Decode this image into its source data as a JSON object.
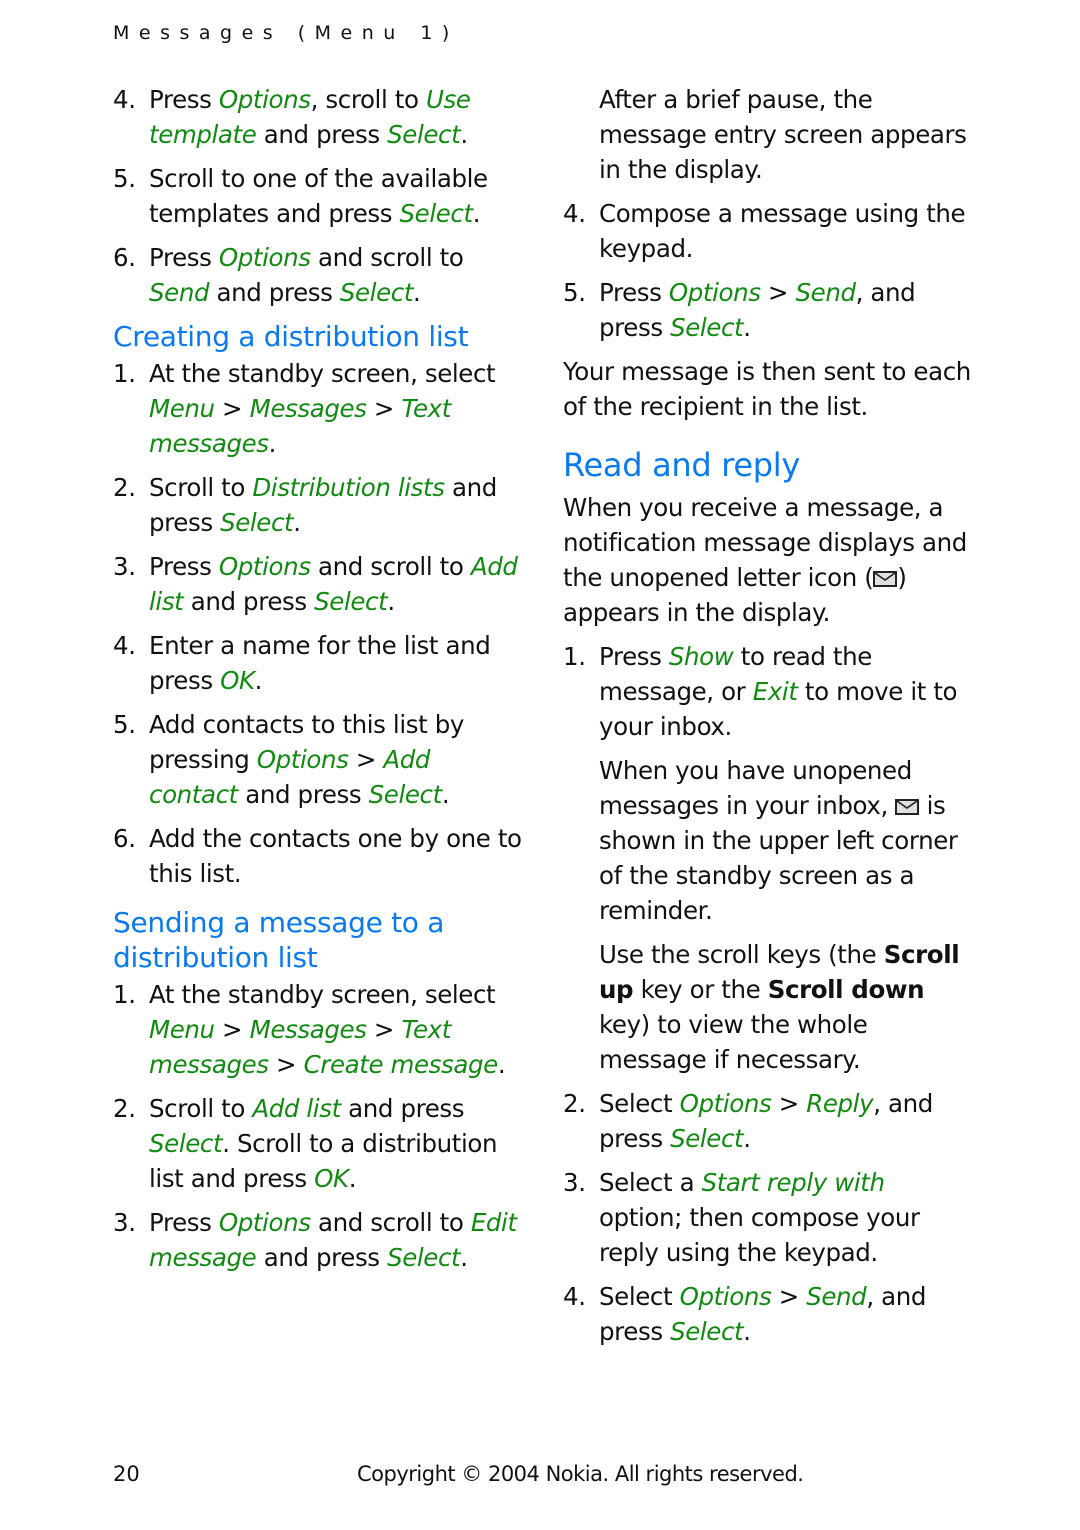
{
  "running_head": "Messages (Menu 1)",
  "left_column": {
    "continued_steps": [
      {
        "num": "4.",
        "parts": [
          [
            "t",
            "Press "
          ],
          [
            "e",
            "Options"
          ],
          [
            "t",
            ", scroll to "
          ],
          [
            "e",
            "Use template"
          ],
          [
            "t",
            " and press "
          ],
          [
            "e",
            "Select"
          ],
          [
            "t",
            "."
          ]
        ]
      },
      {
        "num": "5.",
        "parts": [
          [
            "t",
            "Scroll to one of the available templates and press "
          ],
          [
            "e",
            "Select"
          ],
          [
            "t",
            "."
          ]
        ]
      },
      {
        "num": "6.",
        "parts": [
          [
            "t",
            "Press "
          ],
          [
            "e",
            "Options"
          ],
          [
            "t",
            " and scroll to "
          ],
          [
            "e",
            "Send"
          ],
          [
            "t",
            " and press "
          ],
          [
            "e",
            "Select"
          ],
          [
            "t",
            "."
          ]
        ]
      }
    ],
    "section1": {
      "heading": "Creating a distribution list",
      "steps": [
        {
          "num": "1.",
          "parts": [
            [
              "t",
              "At the standby screen, select "
            ],
            [
              "e",
              "Menu"
            ],
            [
              "t",
              " > "
            ],
            [
              "e",
              "Messages"
            ],
            [
              "t",
              " > "
            ],
            [
              "e",
              "Text messages"
            ],
            [
              "t",
              "."
            ]
          ]
        },
        {
          "num": "2.",
          "parts": [
            [
              "t",
              "Scroll to "
            ],
            [
              "e",
              "Distribution lists"
            ],
            [
              "t",
              " and press "
            ],
            [
              "e",
              "Select"
            ],
            [
              "t",
              "."
            ]
          ]
        },
        {
          "num": "3.",
          "parts": [
            [
              "t",
              "Press "
            ],
            [
              "e",
              "Options"
            ],
            [
              "t",
              " and scroll to "
            ],
            [
              "e",
              "Add list"
            ],
            [
              "t",
              " and press "
            ],
            [
              "e",
              "Select"
            ],
            [
              "t",
              "."
            ]
          ]
        },
        {
          "num": "4.",
          "parts": [
            [
              "t",
              "Enter a name for the list and press "
            ],
            [
              "e",
              "OK"
            ],
            [
              "t",
              "."
            ]
          ]
        },
        {
          "num": "5.",
          "parts": [
            [
              "t",
              "Add contacts to this list by pressing "
            ],
            [
              "e",
              "Options"
            ],
            [
              "t",
              " > "
            ],
            [
              "e",
              "Add contact"
            ],
            [
              "t",
              " and press "
            ],
            [
              "e",
              "Select"
            ],
            [
              "t",
              "."
            ]
          ]
        },
        {
          "num": "6.",
          "parts": [
            [
              "t",
              "Add the contacts one by one to this list."
            ]
          ]
        }
      ]
    },
    "section2": {
      "heading": "Sending a message to a distribution list",
      "steps": [
        {
          "num": "1.",
          "parts": [
            [
              "t",
              "At the standby screen, select "
            ],
            [
              "e",
              "Menu"
            ],
            [
              "t",
              " > "
            ],
            [
              "e",
              "Messages"
            ],
            [
              "t",
              " > "
            ],
            [
              "e",
              "Text messages"
            ],
            [
              "t",
              " > "
            ],
            [
              "e",
              "Create message"
            ],
            [
              "t",
              "."
            ]
          ]
        },
        {
          "num": "2.",
          "parts": [
            [
              "t",
              "Scroll to "
            ],
            [
              "e",
              "Add list"
            ],
            [
              "t",
              " and press "
            ],
            [
              "e",
              "Select"
            ],
            [
              "t",
              ". Scroll to a distribution list and press "
            ],
            [
              "e",
              "OK"
            ],
            [
              "t",
              "."
            ]
          ]
        },
        {
          "num": "3.",
          "parts": [
            [
              "t",
              "Press "
            ],
            [
              "e",
              "Options"
            ],
            [
              "t",
              " and scroll to "
            ],
            [
              "e",
              "Edit message"
            ],
            [
              "t",
              " and press "
            ],
            [
              "e",
              "Select"
            ],
            [
              "t",
              "."
            ]
          ]
        }
      ]
    }
  },
  "right_column": {
    "continuation_note": "After a brief pause, the message entry screen appears in the display.",
    "continued_steps": [
      {
        "num": "4.",
        "parts": [
          [
            "t",
            "Compose a message using the keypad."
          ]
        ]
      },
      {
        "num": "5.",
        "parts": [
          [
            "t",
            "Press "
          ],
          [
            "e",
            "Options"
          ],
          [
            "t",
            " > "
          ],
          [
            "e",
            "Send"
          ],
          [
            "t",
            ", and press "
          ],
          [
            "e",
            "Select"
          ],
          [
            "t",
            "."
          ]
        ]
      }
    ],
    "result_note": "Your message is then sent to each of the recipient in the list.",
    "read_reply": {
      "heading": "Read and reply",
      "intro_parts": [
        [
          "t",
          "When you receive a message, a notification message displays and the unopened letter icon ("
        ],
        [
          "i",
          "envelope"
        ],
        [
          "t",
          ") appears in the display."
        ]
      ],
      "steps": [
        {
          "num": "1.",
          "parts": [
            [
              "t",
              "Press "
            ],
            [
              "e",
              "Show"
            ],
            [
              "t",
              " to read the message, or "
            ],
            [
              "e",
              "Exit"
            ],
            [
              "t",
              " to move it to your inbox."
            ]
          ]
        }
      ],
      "note1_parts": [
        [
          "t",
          "When you have unopened messages in your inbox, "
        ],
        [
          "i",
          "envelope"
        ],
        [
          "t",
          " is shown in the upper left corner of the standby screen as a reminder."
        ]
      ],
      "note2_parts": [
        [
          "t",
          "Use the scroll keys (the "
        ],
        [
          "b",
          "Scroll up"
        ],
        [
          "t",
          " key or the "
        ],
        [
          "b",
          "Scroll down"
        ],
        [
          "t",
          " key) to view the whole message if necessary."
        ]
      ],
      "steps2": [
        {
          "num": "2.",
          "parts": [
            [
              "t",
              "Select "
            ],
            [
              "e",
              "Options"
            ],
            [
              "t",
              " > "
            ],
            [
              "e",
              "Reply"
            ],
            [
              "t",
              ", and press "
            ],
            [
              "e",
              "Select"
            ],
            [
              "t",
              "."
            ]
          ]
        },
        {
          "num": "3.",
          "parts": [
            [
              "t",
              "Select a "
            ],
            [
              "e",
              "Start reply with"
            ],
            [
              "t",
              " option; then compose your reply using the keypad."
            ]
          ]
        },
        {
          "num": "4.",
          "parts": [
            [
              "t",
              "Select "
            ],
            [
              "e",
              "Options"
            ],
            [
              "t",
              " > "
            ],
            [
              "e",
              "Send"
            ],
            [
              "t",
              ", and press "
            ],
            [
              "e",
              "Select"
            ],
            [
              "t",
              "."
            ]
          ]
        }
      ]
    }
  },
  "footer": {
    "page_number": "20",
    "copyright": "Copyright © 2004 Nokia. All rights reserved."
  },
  "colors": {
    "menu_item_green": "#118a11",
    "heading_blue": "#0a7aee",
    "body_text": "#111111"
  }
}
